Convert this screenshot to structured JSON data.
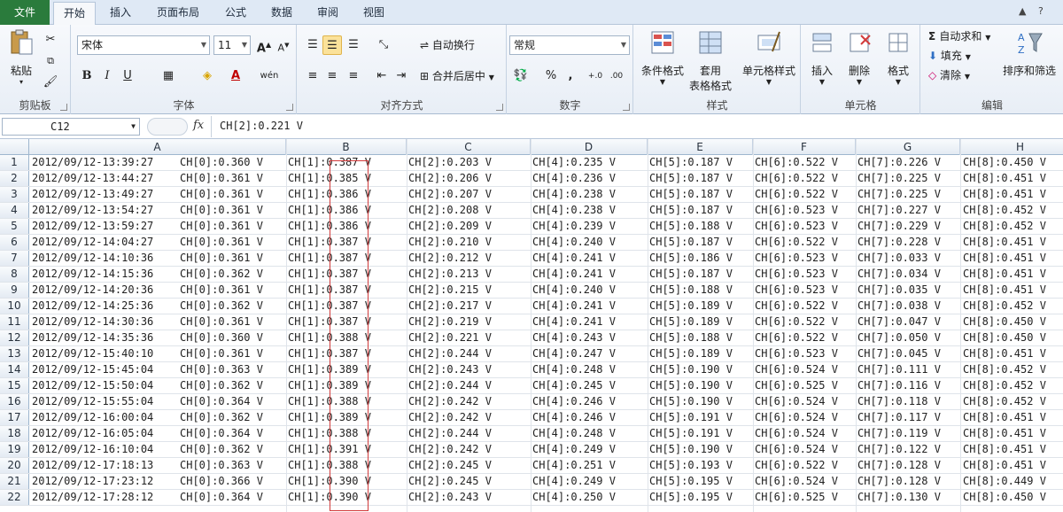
{
  "tabs": {
    "file": "文件",
    "home": "开始",
    "insert": "插入",
    "page_layout": "页面布局",
    "formulas": "公式",
    "data": "数据",
    "review": "审阅",
    "view": "视图"
  },
  "ribbon": {
    "clipboard": {
      "paste": "粘贴",
      "label": "剪贴板"
    },
    "font": {
      "name": "宋体",
      "size": "11",
      "label": "字体"
    },
    "alignment": {
      "wrap": "自动换行",
      "merge": "合并后居中",
      "label": "对齐方式"
    },
    "number": {
      "format": "常规",
      "percent": "%",
      "comma": ",",
      "label": "数字"
    },
    "styles": {
      "conditional": "条件格式",
      "table_l1": "套用",
      "table_l2": "表格格式",
      "cell_styles": "单元格样式",
      "label": "样式"
    },
    "cells": {
      "insert": "插入",
      "delete": "删除",
      "format": "格式",
      "label": "单元格"
    },
    "editing": {
      "autosum": "自动求和",
      "fill": "填充",
      "clear": "清除",
      "sort_filter": "排序和筛选",
      "label": "编辑"
    }
  },
  "formula_bar": {
    "name_box": "C12",
    "fx": "fx",
    "content": "CH[2]:0.221 V"
  },
  "columns": [
    "A",
    "B",
    "C",
    "D",
    "E",
    "F",
    "G",
    "H"
  ],
  "rows": [
    {
      "n": "1",
      "c": [
        "2012/09/12-13:39:27",
        "CH[0]:0.360 V",
        "CH[1]:0.387 V",
        "CH[2]:0.203 V",
        "CH[4]:0.235 V",
        "CH[5]:0.187 V",
        "CH[6]:0.522 V",
        "CH[7]:0.226 V",
        "CH[8]:0.450 V"
      ]
    },
    {
      "n": "2",
      "c": [
        "2012/09/12-13:44:27",
        "CH[0]:0.361 V",
        "CH[1]:0.385 V",
        "CH[2]:0.206 V",
        "CH[4]:0.236 V",
        "CH[5]:0.187 V",
        "CH[6]:0.522 V",
        "CH[7]:0.225 V",
        "CH[8]:0.451 V"
      ]
    },
    {
      "n": "3",
      "c": [
        "2012/09/12-13:49:27",
        "CH[0]:0.361 V",
        "CH[1]:0.386 V",
        "CH[2]:0.207 V",
        "CH[4]:0.238 V",
        "CH[5]:0.187 V",
        "CH[6]:0.522 V",
        "CH[7]:0.225 V",
        "CH[8]:0.451 V"
      ]
    },
    {
      "n": "4",
      "c": [
        "2012/09/12-13:54:27",
        "CH[0]:0.361 V",
        "CH[1]:0.386 V",
        "CH[2]:0.208 V",
        "CH[4]:0.238 V",
        "CH[5]:0.187 V",
        "CH[6]:0.523 V",
        "CH[7]:0.227 V",
        "CH[8]:0.452 V"
      ]
    },
    {
      "n": "5",
      "c": [
        "2012/09/12-13:59:27",
        "CH[0]:0.361 V",
        "CH[1]:0.386 V",
        "CH[2]:0.209 V",
        "CH[4]:0.239 V",
        "CH[5]:0.188 V",
        "CH[6]:0.523 V",
        "CH[7]:0.229 V",
        "CH[8]:0.452 V"
      ]
    },
    {
      "n": "6",
      "c": [
        "2012/09/12-14:04:27",
        "CH[0]:0.361 V",
        "CH[1]:0.387 V",
        "CH[2]:0.210 V",
        "CH[4]:0.240 V",
        "CH[5]:0.187 V",
        "CH[6]:0.522 V",
        "CH[7]:0.228 V",
        "CH[8]:0.451 V"
      ]
    },
    {
      "n": "7",
      "c": [
        "2012/09/12-14:10:36",
        "CH[0]:0.361 V",
        "CH[1]:0.387 V",
        "CH[2]:0.212 V",
        "CH[4]:0.241 V",
        "CH[5]:0.186 V",
        "CH[6]:0.523 V",
        "CH[7]:0.033 V",
        "CH[8]:0.451 V"
      ]
    },
    {
      "n": "8",
      "c": [
        "2012/09/12-14:15:36",
        "CH[0]:0.362 V",
        "CH[1]:0.387 V",
        "CH[2]:0.213 V",
        "CH[4]:0.241 V",
        "CH[5]:0.187 V",
        "CH[6]:0.523 V",
        "CH[7]:0.034 V",
        "CH[8]:0.451 V"
      ]
    },
    {
      "n": "9",
      "c": [
        "2012/09/12-14:20:36",
        "CH[0]:0.361 V",
        "CH[1]:0.387 V",
        "CH[2]:0.215 V",
        "CH[4]:0.240 V",
        "CH[5]:0.188 V",
        "CH[6]:0.523 V",
        "CH[7]:0.035 V",
        "CH[8]:0.451 V"
      ]
    },
    {
      "n": "10",
      "c": [
        "2012/09/12-14:25:36",
        "CH[0]:0.362 V",
        "CH[1]:0.387 V",
        "CH[2]:0.217 V",
        "CH[4]:0.241 V",
        "CH[5]:0.189 V",
        "CH[6]:0.522 V",
        "CH[7]:0.038 V",
        "CH[8]:0.452 V"
      ]
    },
    {
      "n": "11",
      "c": [
        "2012/09/12-14:30:36",
        "CH[0]:0.361 V",
        "CH[1]:0.387 V",
        "CH[2]:0.219 V",
        "CH[4]:0.241 V",
        "CH[5]:0.189 V",
        "CH[6]:0.522 V",
        "CH[7]:0.047 V",
        "CH[8]:0.450 V"
      ]
    },
    {
      "n": "12",
      "c": [
        "2012/09/12-14:35:36",
        "CH[0]:0.360 V",
        "CH[1]:0.388 V",
        "CH[2]:0.221 V",
        "CH[4]:0.243 V",
        "CH[5]:0.188 V",
        "CH[6]:0.522 V",
        "CH[7]:0.050 V",
        "CH[8]:0.450 V"
      ]
    },
    {
      "n": "13",
      "c": [
        "2012/09/12-15:40:10",
        "CH[0]:0.361 V",
        "CH[1]:0.387 V",
        "CH[2]:0.244 V",
        "CH[4]:0.247 V",
        "CH[5]:0.189 V",
        "CH[6]:0.523 V",
        "CH[7]:0.045 V",
        "CH[8]:0.451 V"
      ]
    },
    {
      "n": "14",
      "c": [
        "2012/09/12-15:45:04",
        "CH[0]:0.363 V",
        "CH[1]:0.389 V",
        "CH[2]:0.243 V",
        "CH[4]:0.248 V",
        "CH[5]:0.190 V",
        "CH[6]:0.524 V",
        "CH[7]:0.111 V",
        "CH[8]:0.452 V"
      ]
    },
    {
      "n": "15",
      "c": [
        "2012/09/12-15:50:04",
        "CH[0]:0.362 V",
        "CH[1]:0.389 V",
        "CH[2]:0.244 V",
        "CH[4]:0.245 V",
        "CH[5]:0.190 V",
        "CH[6]:0.525 V",
        "CH[7]:0.116 V",
        "CH[8]:0.452 V"
      ]
    },
    {
      "n": "16",
      "c": [
        "2012/09/12-15:55:04",
        "CH[0]:0.364 V",
        "CH[1]:0.388 V",
        "CH[2]:0.242 V",
        "CH[4]:0.246 V",
        "CH[5]:0.190 V",
        "CH[6]:0.524 V",
        "CH[7]:0.118 V",
        "CH[8]:0.452 V"
      ]
    },
    {
      "n": "17",
      "c": [
        "2012/09/12-16:00:04",
        "CH[0]:0.362 V",
        "CH[1]:0.389 V",
        "CH[2]:0.242 V",
        "CH[4]:0.246 V",
        "CH[5]:0.191 V",
        "CH[6]:0.524 V",
        "CH[7]:0.117 V",
        "CH[8]:0.451 V"
      ]
    },
    {
      "n": "18",
      "c": [
        "2012/09/12-16:05:04",
        "CH[0]:0.364 V",
        "CH[1]:0.388 V",
        "CH[2]:0.244 V",
        "CH[4]:0.248 V",
        "CH[5]:0.191 V",
        "CH[6]:0.524 V",
        "CH[7]:0.119 V",
        "CH[8]:0.451 V"
      ]
    },
    {
      "n": "19",
      "c": [
        "2012/09/12-16:10:04",
        "CH[0]:0.362 V",
        "CH[1]:0.391 V",
        "CH[2]:0.242 V",
        "CH[4]:0.249 V",
        "CH[5]:0.190 V",
        "CH[6]:0.524 V",
        "CH[7]:0.122 V",
        "CH[8]:0.451 V"
      ]
    },
    {
      "n": "20",
      "c": [
        "2012/09/12-17:18:13",
        "CH[0]:0.363 V",
        "CH[1]:0.388 V",
        "CH[2]:0.245 V",
        "CH[4]:0.251 V",
        "CH[5]:0.193 V",
        "CH[6]:0.522 V",
        "CH[7]:0.128 V",
        "CH[8]:0.451 V"
      ]
    },
    {
      "n": "21",
      "c": [
        "2012/09/12-17:23:12",
        "CH[0]:0.366 V",
        "CH[1]:0.390 V",
        "CH[2]:0.245 V",
        "CH[4]:0.249 V",
        "CH[5]:0.195 V",
        "CH[6]:0.524 V",
        "CH[7]:0.128 V",
        "CH[8]:0.449 V"
      ]
    },
    {
      "n": "22",
      "c": [
        "2012/09/12-17:28:12",
        "CH[0]:0.364 V",
        "CH[1]:0.390 V",
        "CH[2]:0.243 V",
        "CH[4]:0.250 V",
        "CH[5]:0.195 V",
        "CH[6]:0.525 V",
        "CH[7]:0.130 V",
        "CH[8]:0.450 V"
      ]
    }
  ],
  "colors": {
    "file_tab": "#2a7b3c",
    "highlight_box": "#d23b3b"
  }
}
